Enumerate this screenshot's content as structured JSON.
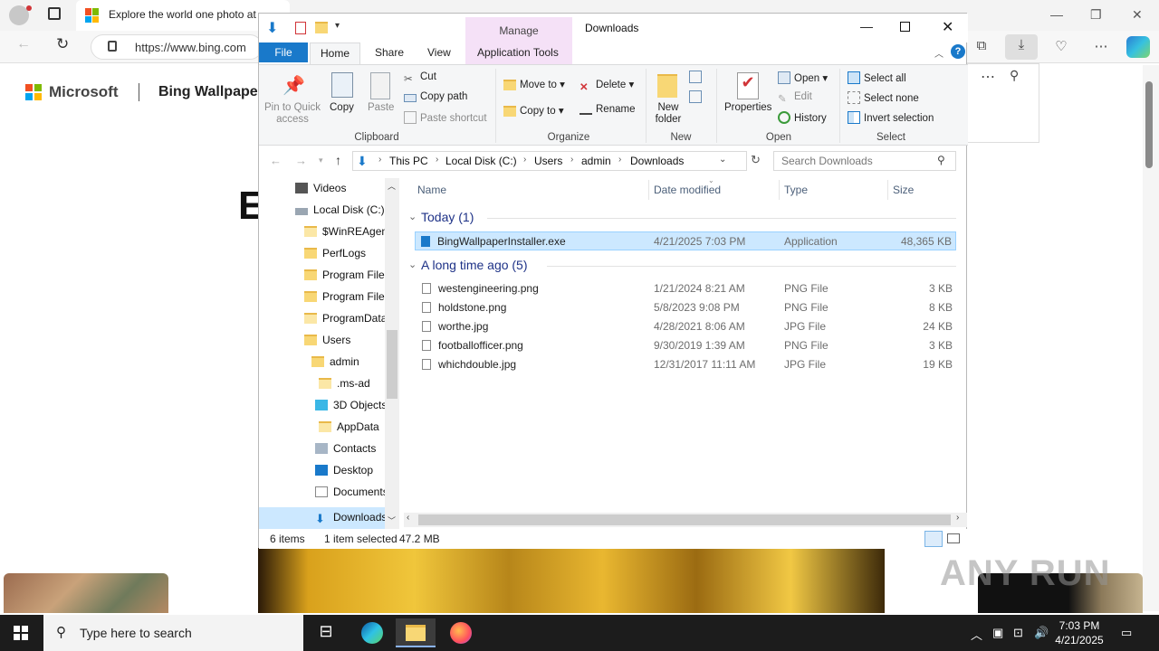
{
  "browser": {
    "tab_title": "Explore the world one photo at",
    "url": "https://www.bing.com",
    "page": {
      "brand": "Microsoft",
      "site_title": "Bing Wallpaper",
      "heading_letter": "E"
    }
  },
  "explorer": {
    "title": "Downloads",
    "manage_label": "Manage",
    "tabs": [
      "File",
      "Home",
      "Share",
      "View",
      "Application Tools"
    ],
    "ribbon": {
      "clipboard": {
        "label": "Clipboard",
        "pin": "Pin to Quick access",
        "copy": "Copy",
        "paste": "Paste",
        "cut": "Cut",
        "copy_path": "Copy path",
        "paste_shortcut": "Paste shortcut"
      },
      "organize": {
        "label": "Organize",
        "move_to": "Move to",
        "copy_to": "Copy to",
        "delete": "Delete",
        "rename": "Rename"
      },
      "new": {
        "label": "New",
        "new_folder": "New folder"
      },
      "open": {
        "label": "Open",
        "properties": "Properties",
        "open": "Open",
        "edit": "Edit",
        "history": "History"
      },
      "select": {
        "label": "Select",
        "select_all": "Select all",
        "select_none": "Select none",
        "invert": "Invert selection"
      }
    },
    "breadcrumb": [
      "This PC",
      "Local Disk (C:)",
      "Users",
      "admin",
      "Downloads"
    ],
    "search_placeholder": "Search Downloads",
    "nav_items": [
      "Videos",
      "Local Disk (C:)",
      "$WinREAgent",
      "PerfLogs",
      "Program Files",
      "Program Files",
      "ProgramData",
      "Users",
      "admin",
      ".ms-ad",
      "3D Objects",
      "AppData",
      "Contacts",
      "Desktop",
      "Documents",
      "Downloads"
    ],
    "columns": [
      "Name",
      "Date modified",
      "Type",
      "Size"
    ],
    "groups": [
      {
        "title": "Today (1)",
        "files": [
          {
            "name": "BingWallpaperInstaller.exe",
            "date": "4/21/2025 7:03 PM",
            "type": "Application",
            "size": "48,365 KB",
            "selected": true
          }
        ]
      },
      {
        "title": "A long time ago (5)",
        "files": [
          {
            "name": "westengineering.png",
            "date": "1/21/2024 8:21 AM",
            "type": "PNG File",
            "size": "3 KB"
          },
          {
            "name": "holdstone.png",
            "date": "5/8/2023 9:08 PM",
            "type": "PNG File",
            "size": "8 KB"
          },
          {
            "name": "worthe.jpg",
            "date": "4/28/2021 8:06 AM",
            "type": "JPG File",
            "size": "24 KB"
          },
          {
            "name": "footballofficer.png",
            "date": "9/30/2019 1:39 AM",
            "type": "PNG File",
            "size": "3 KB"
          },
          {
            "name": "whichdouble.jpg",
            "date": "12/31/2017 11:11 AM",
            "type": "JPG File",
            "size": "19 KB"
          }
        ]
      }
    ],
    "status": {
      "items": "6 items",
      "selected": "1 item selected",
      "size": "47.2 MB"
    }
  },
  "taskbar": {
    "search_placeholder": "Type here to search",
    "time": "7:03 PM",
    "date": "4/21/2025"
  },
  "watermark": "ANY RUN"
}
